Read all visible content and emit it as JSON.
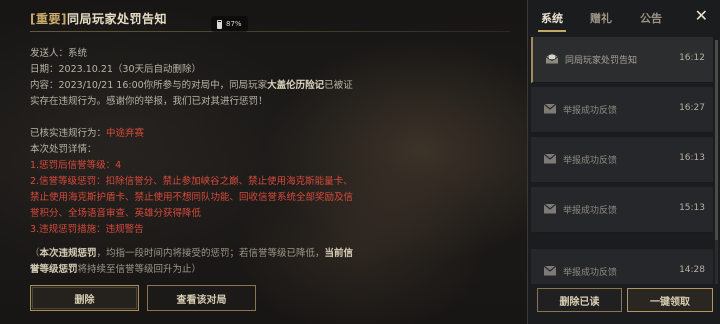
{
  "mail": {
    "title_tag": "[重要]",
    "title": "同局玩家处罚告知",
    "sender_label": "发送人：",
    "sender": "系统",
    "date_label": "日期：",
    "date": "2023.10.21",
    "date_note": "（30天后自动删除）",
    "content_label": "内容：",
    "content_pre": "2023/10/21 16:00你所参与的对局中，同局玩家",
    "player_name": "大盖伦历险记",
    "content_post": "已被证实存在违规行为。感谢你的举报，我们已对其进行惩罚！",
    "violation_label": "已核实违规行为：",
    "violation": "中途弃赛",
    "penalty_details_label": "本次处罚详情：",
    "penalty_1": "1.惩罚后信誉等级：4",
    "penalty_2": "2.信誉等级惩罚：扣除信誉分、禁止参加峡谷之巅、禁止使用海克斯能量卡、禁止使用海克斯护盾卡、禁止使用不想同队功能、回收信誉系统全部奖励及信誉积分、全场语音审查、英雄分获得降低",
    "penalty_3": "3.违规惩罚措施：违规警告",
    "note_open": "（",
    "note_bold_1": "本次违规惩罚",
    "note_mid": "，均指一段时间内将接受的惩罚；若信誉等级已降低，",
    "note_bold_2": "当前信誉等级惩罚",
    "note_end": "将持续至信誉等级回升为止）",
    "delete_button": "删除",
    "view_match_button": "查看该对局"
  },
  "status_bar": {
    "battery": "87%"
  },
  "sidebar": {
    "tabs": [
      {
        "label": "系统",
        "active": true
      },
      {
        "label": "赠礼",
        "active": false
      },
      {
        "label": "公告",
        "active": false
      }
    ],
    "close_label": "✕",
    "items": [
      {
        "name": "同局玩家处罚告知",
        "time": "16:12",
        "selected": true,
        "icon": "mail-read-icon"
      },
      {
        "name": "举报成功反馈",
        "time": "16:27",
        "selected": false,
        "icon": "mail-icon"
      },
      {
        "name": "举报成功反馈",
        "time": "16:13",
        "selected": false,
        "icon": "mail-icon"
      },
      {
        "name": "举报成功反馈",
        "time": "15:13",
        "selected": false,
        "icon": "mail-icon"
      },
      {
        "name": "举报成功反馈",
        "time": "14:28",
        "selected": false,
        "icon": "mail-icon"
      }
    ],
    "delete_read_button": "删除已读",
    "claim_all_button": "一键领取"
  },
  "colors": {
    "accent_gold": "#c8a86a",
    "penalty_red": "#d64a3c"
  }
}
